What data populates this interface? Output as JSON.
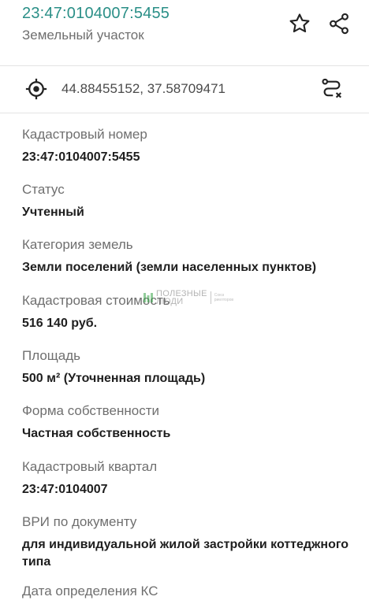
{
  "header": {
    "title": "23:47:0104007:5455",
    "subtitle": "Земельный участок",
    "favorite_icon": "star-icon",
    "share_icon": "share-icon"
  },
  "location": {
    "coordinates": "44.88455152, 37.58709471",
    "locate_icon": "crosshair-icon",
    "route_icon": "route-icon"
  },
  "fields": [
    {
      "label": "Кадастровый номер",
      "value": "23:47:0104007:5455"
    },
    {
      "label": "Статус",
      "value": "Учтенный"
    },
    {
      "label": "Категория земель",
      "value": "Земли поселений (земли населенных пунктов)"
    },
    {
      "label": "Кадастровая стоимость",
      "value": "516 140 руб."
    },
    {
      "label": "Площадь",
      "value": "500 м² (Уточненная площадь)"
    },
    {
      "label": "Форма собственности",
      "value": "Частная собственность"
    },
    {
      "label": "Кадастровый квартал",
      "value": "23:47:0104007"
    },
    {
      "label": "ВРИ по документу",
      "value": "для индивидуальной жилой застройки коттеджного типа"
    },
    {
      "label": "Дата определения КС",
      "value": ""
    }
  ],
  "watermark": {
    "line1": "Полезные",
    "line2": "люди",
    "small": "Союз риелторов"
  },
  "colors": {
    "accent": "#2a8f87",
    "label": "#6f6f6f",
    "value": "#1e1e1e",
    "divider": "#e3e3e3"
  }
}
